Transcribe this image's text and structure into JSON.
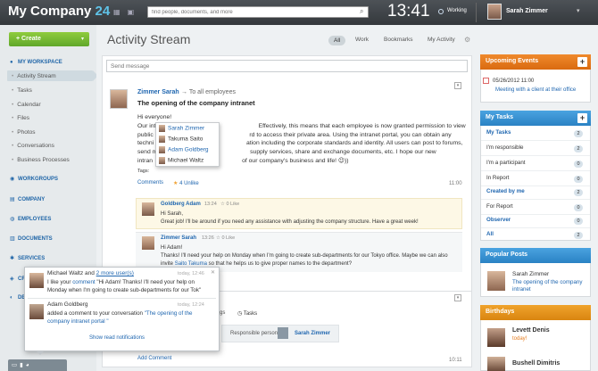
{
  "header": {
    "logo_main": "My Company",
    "logo_num": "24",
    "search_placeholder": "find people, documents, and more",
    "clock": "13:41",
    "work_status": "Working",
    "user_name": "Sarah Zimmer"
  },
  "sidebar": {
    "create_label": "Create",
    "my_workspace": "MY WORKSPACE",
    "items": [
      "Activity Stream",
      "Tasks",
      "Calendar",
      "Files",
      "Photos",
      "Conversations",
      "Business Processes"
    ],
    "sections": [
      "WORKGROUPS",
      "COMPANY",
      "EMPLOYEES",
      "DOCUMENTS",
      "SERVICES",
      "CR",
      "DE"
    ]
  },
  "main": {
    "title": "Activity Stream",
    "tabs": [
      "All",
      "Work",
      "Bookmarks",
      "My Activity"
    ],
    "send_placeholder": "Send message"
  },
  "post": {
    "author": "Zimmer Sarah",
    "to": "To all employees",
    "title": "The opening of the company intranet",
    "line1": "Hi everyone!",
    "line2": "Our int                                                             Effectively, this means that each employee is now granted permission to view",
    "line3": "public                                                         rd to access their private area. Using the intranet portal, you can obtain any",
    "line4": "techni                                                       ation including the corporate standards and identity. All users can post to forums,",
    "line5": "send m                                                       supply services, share and exchange documents, etc. I hope our new",
    "line6": "intran                                                     of our company's business and life! 😉))",
    "tags_label": "Tags:",
    "comments": "Comments",
    "unlike": "4 Unlike",
    "time": "11:00"
  },
  "mention_popup": {
    "items": [
      "Sarah Zimmer",
      "Takuma Saito",
      "Adam Goldberg",
      "Michael Waltz"
    ]
  },
  "comments": [
    {
      "author": "Goldberg Adam",
      "time": "13:24",
      "like": "0 Like",
      "text": "Hi Sarah,",
      "text2": "Great job! I'll be around if you need any assistance with adjusting the company structure. Have a great week!"
    },
    {
      "author": "Zimmer Sarah",
      "time": "13:26",
      "like": "0 Like",
      "text": "Hi Adam!",
      "text2": "Thanks! I'll need your help on Monday when I'm going to create sub-departments for our Tokyo office. Maybe we can also",
      "text3_pre": "invite ",
      "text3_link": "Saito Takuma",
      "text3_post": " so that he helps us to give proper names to the department?"
    }
  ],
  "post2": {
    "tabs_tail": "gs",
    "tasks": "Tasks",
    "responsible": "Responsible person:",
    "responsible_name": "Sarah Zimmer",
    "add_comment": "Add Comment",
    "time": "10:11"
  },
  "notifications": {
    "n1_head_pre": "Michael Waltz and ",
    "n1_head_link": "2 more user(s)",
    "n1_time": "today, 12:46",
    "n1_text_pre": "I like your ",
    "n1_text_link": "comment",
    "n1_text_post": " \"Hi Adam! Thanks! I'll need your help on Monday when I'm going to create sub-departments for our Tok\"",
    "n2_head": "Adam Goldberg",
    "n2_time": "today, 12:24",
    "n2_text_pre": "added a comment to your conversation ",
    "n2_text_link": "\"The opening of the company intranet portal \"",
    "show_read": "Show read notifications"
  },
  "right": {
    "events_title": "Upcoming Events",
    "event_date": "05/26/2012 11:00",
    "event_title": "Meeting with a client at their office",
    "tasks_title": "My Tasks",
    "tasks": [
      {
        "label": "My Tasks",
        "count": "2",
        "bold": true
      },
      {
        "label": "I'm responsible",
        "count": "2",
        "bold": false
      },
      {
        "label": "I'm a participant",
        "count": "0",
        "bold": false
      },
      {
        "label": "In Report",
        "count": "0",
        "bold": false
      },
      {
        "label": "Created by me",
        "count": "2",
        "bold": true
      },
      {
        "label": "For Report",
        "count": "0",
        "bold": false
      },
      {
        "label": "Observer",
        "count": "0",
        "bold": true
      },
      {
        "label": "All",
        "count": "2",
        "bold": true
      }
    ],
    "popular_title": "Popular Posts",
    "popular_author": "Sarah Zimmer",
    "popular_post": "The opening of the company intranet",
    "birthdays_title": "Birthdays",
    "bd1_name": "Levett Denis",
    "bd1_when": "today!",
    "bd2_name": "Bushell Dimitris"
  },
  "colors": {
    "accent": "#2067b0",
    "create_green": "#6cb12f",
    "events_orange": "#e57a1c",
    "tasks_blue": "#3a93d4"
  }
}
